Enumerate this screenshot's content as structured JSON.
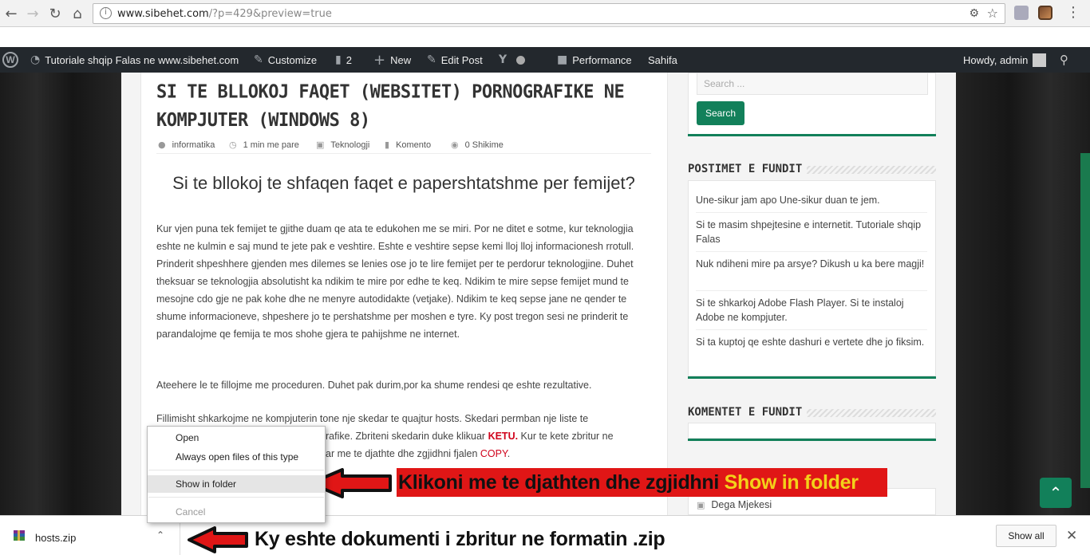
{
  "browser": {
    "url_host": "www.sibehet.com",
    "url_path": "/?p=429&preview=true"
  },
  "admin_bar": {
    "site_name": "Tutoriale shqip Falas ne www.sibehet.com",
    "customize": "Customize",
    "comments_count": "2",
    "new_label": "New",
    "edit_post": "Edit Post",
    "performance": "Performance",
    "sahifa": "Sahifa",
    "howdy": "Howdy, admin"
  },
  "post": {
    "title": "SI TE BLLOKOJ FAQET (WEBSITET) PORNOGRAFIKE NE KOMPJUTER (WINDOWS 8)",
    "meta": {
      "author": "informatika",
      "time": "1 min me pare",
      "category": "Teknologji",
      "comments": "Komento",
      "views": "0 Shikime"
    },
    "heading": "Si te bllokoj te shfaqen faqet e papershtatshme per femijet?",
    "para1": "Kur vjen puna tek femijet te gjithe duam qe ata te edukohen me se miri. Por ne ditet e sotme, kur teknologjia eshte ne kulmin e saj mund te jete pak e veshtire. Eshte e veshtire sepse kemi lloj lloj informacionesh rrotull. Prinderit shpeshhere gjenden mes dilemes se lenies ose jo te lire femijet per te perdorur teknologjine. Duhet theksuar se teknologjia absolutisht ka ndikim te mire por edhe te keq. Ndikim te mire sepse femijet mund te mesojne cdo gje ne pak kohe dhe ne menyre autodidakte (vetjake). Ndikim te keq sepse jane ne qender te shume informacioneve, shpeshere jo te pershatshme per moshen e tyre. Ky post tregon sesi ne prinderit te parandalojme qe femija te mos shohe gjera te pahijshme ne internet.",
    "para2": "Ateehere le te fillojme me proceduren. Duhet pak durim,por ka shume rendesi qe eshte rezultative.",
    "para3_line1": "Fillimisht shkarkojme ne kompjuterin tone nje skedar te quajtur hosts. Skedari permban nje liste te",
    "para3_line2a": "rafike. Zbriteni skedarin duke klikuar ",
    "para3_ketu": "KETU.",
    "para3_line2b": " Kur te kete zbritur ne",
    "para3_line3a": "ar me te djathte dhe zgjidhni fjalen ",
    "para3_copy": "COPY",
    "para3_line3b": "."
  },
  "sidebar": {
    "search_placeholder": "Search ...",
    "search_button": "Search",
    "recent_title": "POSTIMET E FUNDIT",
    "recent_posts": [
      "Une-sikur jam apo Une-sikur duan te jem.",
      "Si te masim shpejtesine e internetit. Tutoriale shqip Falas",
      "Nuk ndiheni mire pa arsye? Dikush u ka bere magji!",
      "Si te shkarkoj Adobe Flash Player. Si te instaloj Adobe ne kompjuter.",
      "Si ta kuptoj qe eshte dashuri e vertete dhe jo fiksim."
    ],
    "comments_title": "KOMENTET E FUNDIT",
    "category_partial": "Dega Mjekesi"
  },
  "context_menu": {
    "open": "Open",
    "always_open": "Always open files of this type",
    "show_in_folder": "Show in folder",
    "cancel": "Cancel"
  },
  "annotations": {
    "arrow1_text_a": "Klikoni me te djathten dhe zgjidhni ",
    "arrow1_text_b": "Show in folder",
    "arrow2_text": "Ky eshte dokumenti i zbritur ne formatin .zip"
  },
  "download_shelf": {
    "file_name": "hosts.zip",
    "show_all": "Show all"
  },
  "colors": {
    "accent_green": "#12805a",
    "annotation_red": "#e01616",
    "annotation_yellow": "#f3d11a",
    "wp_bar": "#23282d"
  }
}
